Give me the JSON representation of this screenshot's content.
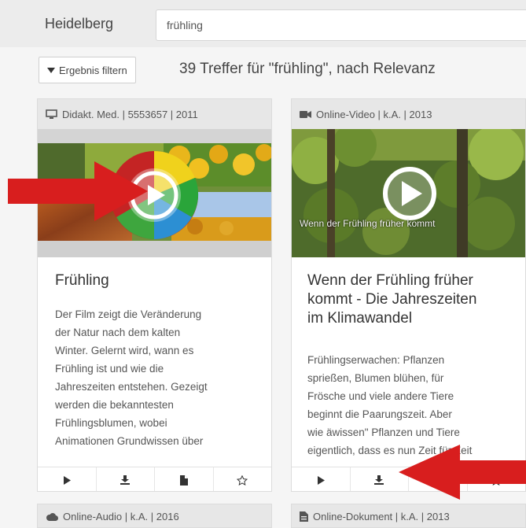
{
  "header": {
    "city": "Heidelberg",
    "search_value": "frühling"
  },
  "results": {
    "filter_label": "Ergebnis filtern",
    "summary": "39 Treffer für \"frühling\", nach Relevanz"
  },
  "cards": [
    {
      "meta": "Didakt. Med. | 5553657 | 2011",
      "title": "Frühling",
      "desc_lines": [
        "Der Film zeigt die Veränderung",
        "der Natur nach dem kalten",
        "Winter. Gelernt wird, wann es",
        "Frühling ist und wie die",
        "Jahreszeiten entstehen. Gezeigt",
        "werden die bekanntesten",
        "Frühlingsblumen, wobei",
        "Animationen Grundwissen über"
      ]
    },
    {
      "meta": "Online-Video | k.A. | 2013",
      "thumb_caption": "Wenn der Frühling früher kommt",
      "title_lines": [
        "Wenn der Frühling früher",
        "kommt - Die Jahreszeiten",
        "im Klimawandel"
      ],
      "desc_lines": [
        "Frühlingserwachen: Pflanzen",
        "sprießen, Blumen blühen, für",
        "Frösche und viele andere Tiere",
        "beginnt die Paarungszeit. Aber",
        "wie äwissen\" Pflanzen und Tiere",
        "eigentlich, dass es nun Zeit für Zeit"
      ]
    },
    {
      "meta": "Online-Audio | k.A. | 2016"
    },
    {
      "meta": "Online-Dokument | k.A. | 2013"
    }
  ],
  "icons": {
    "monitor": "monitor-icon",
    "video": "video-camera-icon",
    "cloud": "cloud-icon",
    "document": "document-icon",
    "play": "play-icon",
    "download": "download-icon",
    "file": "file-icon",
    "star": "star-icon",
    "filter": "filter-icon"
  },
  "colors": {
    "annotation_arrow": "#d81e1e",
    "card_header": "#e7e7e7"
  }
}
